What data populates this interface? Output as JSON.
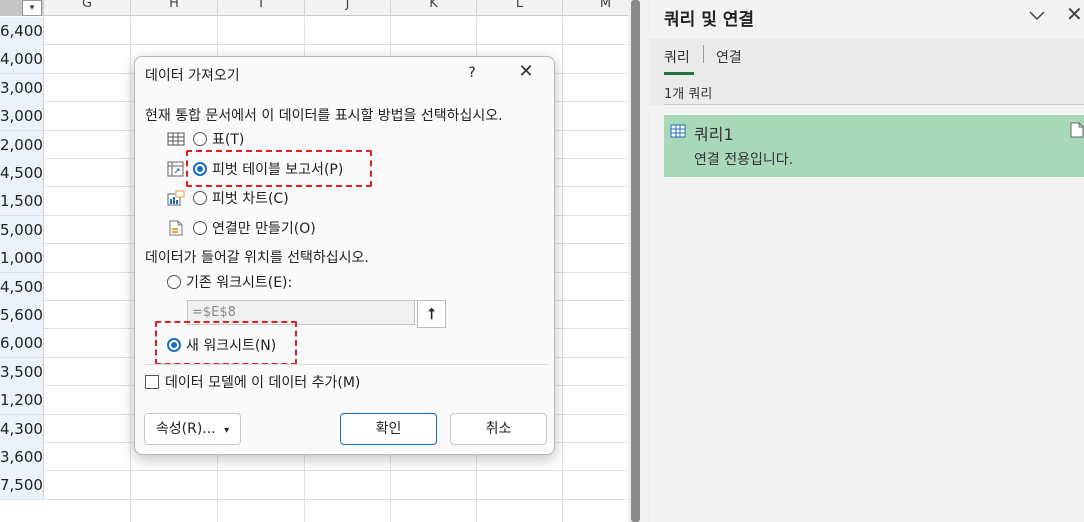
{
  "sheet": {
    "columns": [
      "G",
      "H",
      "I",
      "J",
      "K",
      "L",
      "M"
    ],
    "filter_glyph": "▾",
    "values": [
      "6,400",
      "4,000",
      "3,000",
      "3,000",
      "2,000",
      "4,500",
      "1,500",
      "5,000",
      "1,000",
      "4,500",
      "5,600",
      "6,000",
      "3,500",
      "1,200",
      "4,300",
      "3,600",
      "7,500"
    ]
  },
  "dialog": {
    "title": "데이터 가져오기",
    "help": "?",
    "close": "✕",
    "prompt_display": "현재 통합 문서에서 이 데이터를 표시할 방법을 선택하십시오.",
    "options_display": [
      {
        "label": "표(T)",
        "icon": "table-icon",
        "selected": false
      },
      {
        "label": "피벗 테이블 보고서(P)",
        "icon": "pivot-table-icon",
        "selected": true
      },
      {
        "label": "피벗 차트(C)",
        "icon": "pivot-chart-icon",
        "selected": false
      },
      {
        "label": "연결만 만들기(O)",
        "icon": "connection-only-icon",
        "selected": false
      }
    ],
    "prompt_location": "데이터가 들어갈 위치를 선택하십시오.",
    "options_location": [
      {
        "label": "기존 워크시트(E):",
        "selected": false
      },
      {
        "label": "새 워크시트(N)",
        "selected": true
      }
    ],
    "ref_value": "=$E$8",
    "ref_button": "⭡",
    "add_model_label": "데이터 모델에 이 데이터 추가(M)",
    "add_model_checked": false,
    "properties_button": "속성(R)...",
    "properties_arrow": "▾",
    "ok_button": "확인",
    "cancel_button": "취소",
    "accent": "#1a6fc4",
    "highlight": "#e02020"
  },
  "pane": {
    "title": "쿼리 및 연결",
    "chevron": "∨",
    "close": "✕",
    "tabs": [
      "쿼리",
      "연결"
    ],
    "active_tab": "쿼리",
    "count_label": "1개 쿼리",
    "queries": [
      {
        "name": "쿼리1",
        "description": "연결 전용입니다."
      }
    ],
    "card_color": "#a9d8b8",
    "tab_accent": "#217346"
  }
}
